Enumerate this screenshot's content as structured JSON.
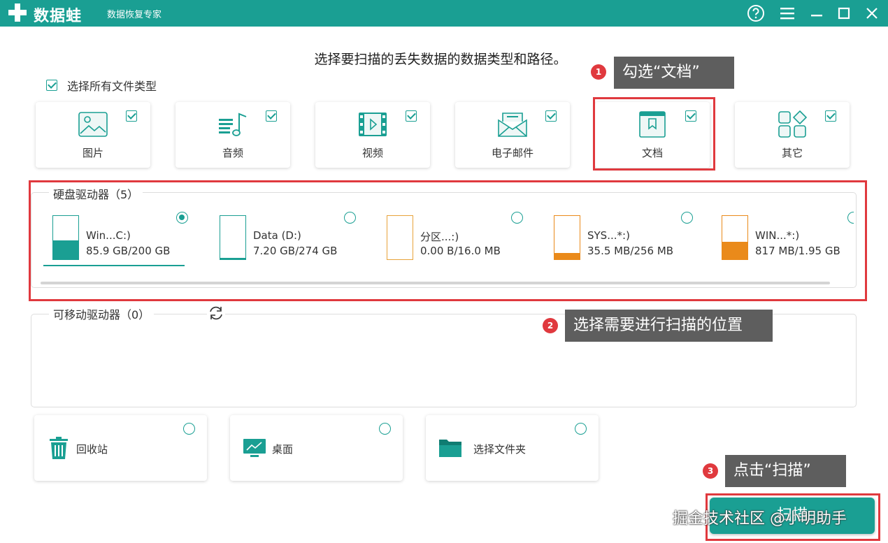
{
  "app": {
    "name": "数据蛙",
    "subtitle": "数据恢复专家"
  },
  "heading": "选择要扫描的丢失数据的数据类型和路径。",
  "select_all": {
    "label": "选择所有文件类型",
    "checked": true
  },
  "file_types": [
    {
      "label": "图片",
      "icon": "image-icon",
      "checked": true
    },
    {
      "label": "音频",
      "icon": "music-icon",
      "checked": true
    },
    {
      "label": "视频",
      "icon": "video-icon",
      "checked": true
    },
    {
      "label": "电子邮件",
      "icon": "email-icon",
      "checked": true
    },
    {
      "label": "文档",
      "icon": "document-icon",
      "checked": true
    },
    {
      "label": "其它",
      "icon": "other-icon",
      "checked": true
    }
  ],
  "hard_drives": {
    "title": "硬盘驱动器（5）",
    "items": [
      {
        "name": "Win...C:)",
        "size": "85.9 GB/200 GB",
        "used_fraction": 0.43,
        "color": "#1a9f93",
        "selected": true
      },
      {
        "name": "Data (D:)",
        "size": "7.20 GB/274 GB",
        "used_fraction": 0.03,
        "color": "#1a9f93",
        "selected": false
      },
      {
        "name": "分区...:)",
        "size": "0.00  B/16.0 MB",
        "used_fraction": 0.0,
        "color": "#e8a33a",
        "selected": false
      },
      {
        "name": "SYS...*:)",
        "size": "35.5 MB/256 MB",
        "used_fraction": 0.14,
        "color": "#ea8a1a",
        "selected": false
      },
      {
        "name": "WIN...*:)",
        "size": "817 MB/1.95 GB",
        "used_fraction": 0.41,
        "color": "#ea8a1a",
        "selected": false
      }
    ]
  },
  "removable_drives": {
    "title": "可移动驱动器（0）"
  },
  "locations": [
    {
      "label": "回收站",
      "icon": "recycle-bin-icon",
      "selected": false
    },
    {
      "label": "桌面",
      "icon": "desktop-icon",
      "selected": false
    },
    {
      "label": "选择文件夹",
      "icon": "folder-icon",
      "selected": false
    }
  ],
  "callouts": [
    {
      "number": "1",
      "text": "勾选“文档”"
    },
    {
      "number": "2",
      "text": "选择需要进行扫描的位置"
    },
    {
      "number": "3",
      "text": "点击“扫描”"
    }
  ],
  "scan_button": {
    "label": "扫描"
  },
  "watermark": "掘金技术社区 @小明助手",
  "colors": {
    "accent": "#1a9f93",
    "highlight": "#e0393e",
    "callout_bg": "#5e5e5e"
  }
}
